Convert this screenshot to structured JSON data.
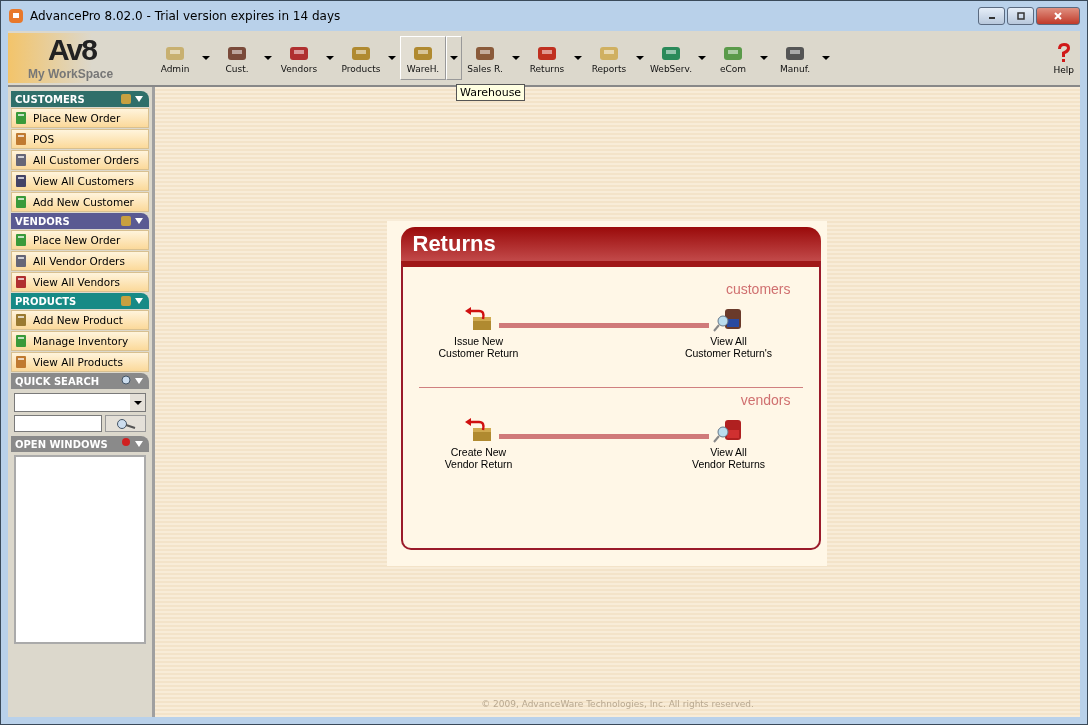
{
  "window": {
    "title": "AdvancePro 8.02.0 - Trial version expires in 14 days"
  },
  "logo": {
    "mark": "Av8",
    "caption": "My WorkSpace"
  },
  "toolbar": [
    {
      "label": "Admin",
      "hovered": false
    },
    {
      "label": "Cust.",
      "hovered": false
    },
    {
      "label": "Vendors",
      "hovered": false
    },
    {
      "label": "Products",
      "hovered": false
    },
    {
      "label": "WareH.",
      "hovered": true
    },
    {
      "label": "Sales R.",
      "hovered": false
    },
    {
      "label": "Returns",
      "hovered": false
    },
    {
      "label": "Reports",
      "hovered": false
    },
    {
      "label": "WebServ.",
      "hovered": false
    },
    {
      "label": "eCom",
      "hovered": false
    },
    {
      "label": "Manuf.",
      "hovered": false
    }
  ],
  "help": {
    "label": "Help"
  },
  "tooltip": "Warehouse",
  "sidebar": {
    "sections": [
      {
        "title": "CUSTOMERS",
        "color": "#2f6f6a",
        "items": [
          "Place New Order",
          "POS",
          "All Customer Orders",
          "View All Customers",
          "Add New Customer"
        ]
      },
      {
        "title": "VENDORS",
        "color": "#5a5a92",
        "items": [
          "Place New Order",
          "All Vendor Orders",
          "View All Vendors"
        ]
      },
      {
        "title": "PRODUCTS",
        "color": "#178a86",
        "items": [
          "Add New Product",
          "Manage Inventory",
          "View All Products"
        ]
      }
    ],
    "quick_search": {
      "title": "QUICK SEARCH"
    },
    "open_windows": {
      "title": "OPEN WINDOWS"
    }
  },
  "panel": {
    "title": "Returns",
    "groups": [
      {
        "heading": "customers",
        "from": [
          "Issue New",
          "Customer Return"
        ],
        "to": [
          "View All",
          "Customer Return's"
        ]
      },
      {
        "heading": "vendors",
        "from": [
          "Create New",
          "Vendor Return"
        ],
        "to": [
          "View All",
          "Vendor Returns"
        ]
      }
    ]
  },
  "footer": "© 2009, AdvanceWare Technologies, Inc. All rights reserved."
}
